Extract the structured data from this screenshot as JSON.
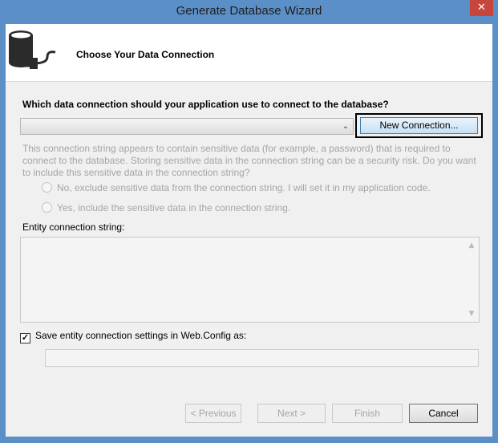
{
  "window": {
    "title": "Generate Database Wizard",
    "close_glyph": "✕"
  },
  "header": {
    "title": "Choose Your Data Connection",
    "icon": "database-plug-icon"
  },
  "connection": {
    "question": "Which data connection should your application use to connect to the database?",
    "selected": "",
    "dropdown_glyph": "⌄",
    "new_connection_label": "New Connection..."
  },
  "sensitive": {
    "info": "This connection string appears to contain sensitive data (for example, a password) that is required to connect to the database. Storing sensitive data in the connection string can be a security risk. Do you want to include this sensitive data in the connection string?",
    "option_no": "No, exclude sensitive data from the connection string. I will set it in my application code.",
    "option_yes": "Yes, include the sensitive data in the connection string."
  },
  "entity": {
    "label": "Entity connection string:",
    "value": "",
    "scroll_up_glyph": "▲",
    "scroll_down_glyph": "▼"
  },
  "save": {
    "label": "Save entity connection settings in Web.Config as:",
    "checked": true,
    "check_glyph": "✓",
    "value": ""
  },
  "buttons": {
    "previous": "< Previous",
    "next": "Next >",
    "finish": "Finish",
    "cancel": "Cancel"
  },
  "colors": {
    "titlebar": "#5b8fc7",
    "close": "#c7463c",
    "disabled_text": "#a5a5a5"
  }
}
